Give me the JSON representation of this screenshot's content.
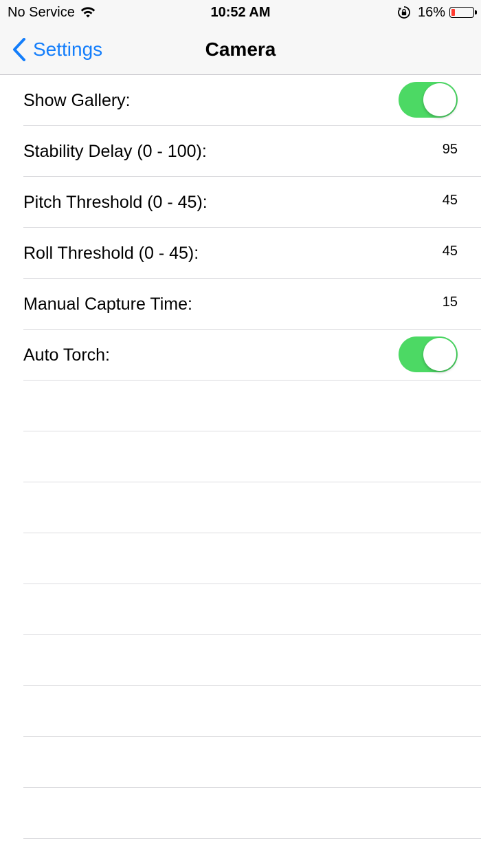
{
  "status_bar": {
    "carrier": "No Service",
    "time": "10:52 AM",
    "battery_percent": "16%",
    "battery_level": 0.16,
    "battery_color": "#ff3b30"
  },
  "nav": {
    "back_label": "Settings",
    "title": "Camera",
    "accent_color": "#147efb"
  },
  "settings": {
    "show_gallery": {
      "label": "Show Gallery:",
      "on": true
    },
    "stability_delay": {
      "label": "Stability Delay (0 - 100):",
      "value": "95"
    },
    "pitch_threshold": {
      "label": "Pitch Threshold (0 - 45):",
      "value": "45"
    },
    "roll_threshold": {
      "label": "Roll Threshold (0 - 45):",
      "value": "45"
    },
    "manual_capture_time": {
      "label": "Manual Capture Time:",
      "value": "15"
    },
    "auto_torch": {
      "label": "Auto Torch:",
      "on": true
    }
  },
  "toggle_on_color": "#4cd964"
}
